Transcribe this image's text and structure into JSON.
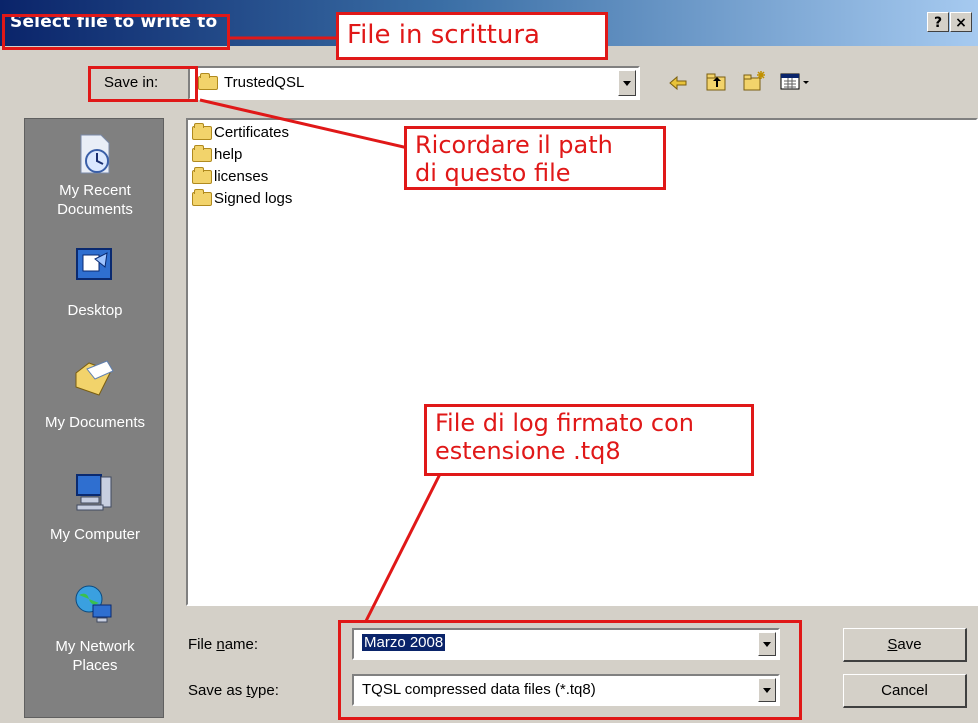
{
  "window": {
    "title": "Select file to write to",
    "help_button": "?",
    "close_button": "×"
  },
  "save_in": {
    "label": "Save in:",
    "value": "TrustedQSL"
  },
  "toolbar_icons": [
    "back-arrow-icon",
    "up-folder-icon",
    "new-folder-icon",
    "view-menu-icon"
  ],
  "places": [
    {
      "label": "My Recent\nDocuments",
      "icon": "recent-documents-icon"
    },
    {
      "label": "Desktop",
      "icon": "desktop-icon"
    },
    {
      "label": "My Documents",
      "icon": "my-documents-icon"
    },
    {
      "label": "My Computer",
      "icon": "my-computer-icon"
    },
    {
      "label": "My Network\nPlaces",
      "icon": "network-places-icon"
    }
  ],
  "files": [
    "Certificates",
    "help",
    "licenses",
    "Signed logs"
  ],
  "file_name": {
    "label_pre": "File ",
    "label_key": "n",
    "label_post": "ame:",
    "value": "Marzo 2008"
  },
  "save_as_type": {
    "label_pre": "Save as ",
    "label_key": "t",
    "label_post": "ype:",
    "value": "TQSL compressed data files (*.tq8)"
  },
  "buttons": {
    "save_key": "S",
    "save_rest": "ave",
    "cancel": "Cancel"
  },
  "annotations": {
    "title_note": "File in scrittura",
    "path_note_1": "Ricordare il path",
    "path_note_2": "di questo file",
    "log_note_1": "File di log firmato con",
    "log_note_2": "estensione .tq8"
  },
  "colors": {
    "annotation_red": "#e01818",
    "title_blue": "#0a246a",
    "dialog_grey": "#d4d0c8"
  }
}
